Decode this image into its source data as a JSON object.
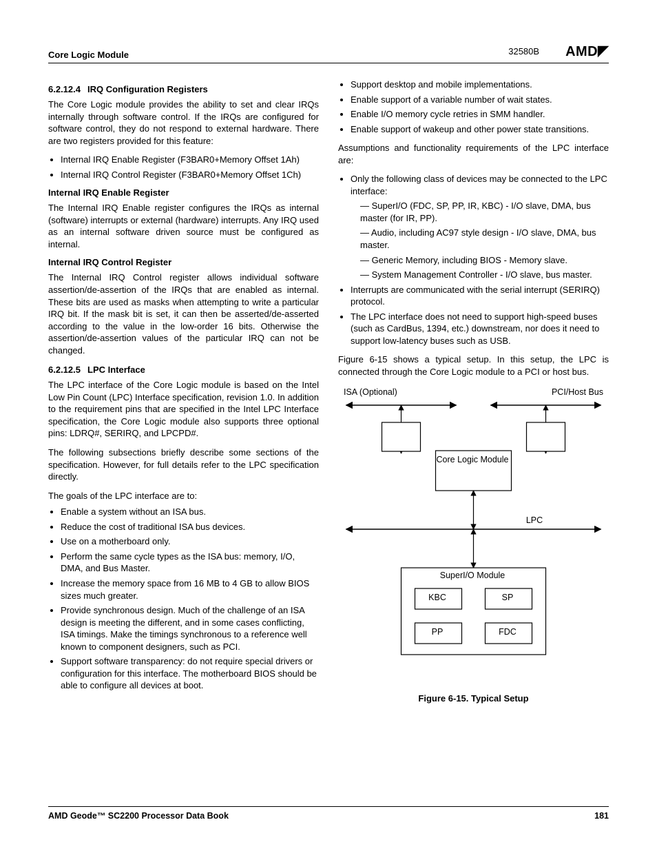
{
  "header": {
    "left": "Core Logic Module",
    "docnum": "32580B",
    "logo": "AMD"
  },
  "col1": {
    "s1_num": "6.2.12.4",
    "s1_title": "IRQ Configuration Registers",
    "s1_p1": "The Core Logic module provides the ability to set and clear IRQs internally through software control. If the IRQs are configured for software control, they do not respond to external hardware. There are two registers provided for this feature:",
    "s1_b1": "Internal IRQ Enable Register (F3BAR0+Memory Offset 1Ah)",
    "s1_b2": "Internal IRQ Control Register (F3BAR0+Memory Offset 1Ch)",
    "s1_h1": "Internal IRQ Enable Register",
    "s1_p2": "The Internal IRQ Enable register configures the IRQs as internal (software) interrupts or external (hardware) interrupts. Any IRQ used as an internal software driven source must be configured as internal.",
    "s1_h2": "Internal IRQ Control Register",
    "s1_p3": "The Internal IRQ Control register allows individual software assertion/de-assertion of the IRQs that are enabled as internal. These bits are used as masks when attempting to write a particular IRQ bit. If the mask bit is set, it can then be asserted/de-asserted according to the value in the low-order 16 bits. Otherwise the assertion/de-assertion values of the particular IRQ can not be changed.",
    "s2_num": "6.2.12.5",
    "s2_title": "LPC Interface",
    "s2_p1": "The LPC interface of the Core Logic module is based on the Intel Low Pin Count (LPC) Interface specification, revision 1.0. In addition to the requirement pins that are specified in the Intel LPC Interface specification, the Core Logic module also supports three optional pins: LDRQ#, SERIRQ, and LPCPD#.",
    "s2_p2": "The following subsections briefly describe some sections of the specification. However, for full details refer to the LPC specification directly.",
    "s2_p3": "The goals of the LPC interface are to:",
    "s2_goals": [
      "Enable a system without an ISA bus.",
      "Reduce the cost of traditional ISA bus devices.",
      "Use on a motherboard only.",
      "Perform the same cycle types as the ISA bus: memory, I/O, DMA, and Bus Master.",
      "Increase the memory space from 16 MB to 4 GB to allow BIOS sizes much greater.",
      "Provide synchronous design. Much of the challenge of an ISA design is meeting the different, and in some cases conflicting, ISA timings. Make the timings synchronous to a reference well known to component designers, such as PCI.",
      "Support software transparency: do not require special drivers or configuration for this interface. The motherboard BIOS should be able to configure all devices at boot."
    ]
  },
  "col2": {
    "top_goals": [
      "Support desktop and mobile implementations.",
      "Enable support of a variable number of wait states.",
      "Enable I/O memory cycle retries in SMM handler.",
      "Enable support of wakeup and other power state transitions."
    ],
    "p_assume": "Assumptions and functionality requirements of the LPC interface are:",
    "assume_items": {
      "a1": "Only the following class of devices may be connected to the LPC interface:",
      "a1_sub": [
        "SuperI/O (FDC, SP, PP, IR, KBC) - I/O slave, DMA, bus master (for IR, PP).",
        "Audio, including AC97 style design - I/O slave, DMA, bus master.",
        "Generic Memory, including BIOS - Memory slave.",
        "System Management Controller - I/O slave, bus master."
      ],
      "a2": "Interrupts are communicated with the serial interrupt (SERIRQ) protocol.",
      "a3": "The LPC interface does not need to support high-speed buses (such as CardBus, 1394, etc.) downstream, nor does it need to support low-latency buses such as USB."
    },
    "p_fig": "Figure 6-15 shows a typical setup. In this setup, the LPC is connected through the Core Logic module to a PCI or host bus.",
    "fig": {
      "isa": "ISA (Optional)",
      "pci": "PCI/Host Bus",
      "core": "Core Logic Module",
      "lpc": "LPC",
      "sio": "SuperI/O Module",
      "kbc": "KBC",
      "sp": "SP",
      "pp": "PP",
      "fdc": "FDC",
      "caption": "Figure 6-15.  Typical Setup"
    }
  },
  "footer": {
    "left": "AMD Geode™ SC2200  Processor Data Book",
    "right": "181"
  }
}
